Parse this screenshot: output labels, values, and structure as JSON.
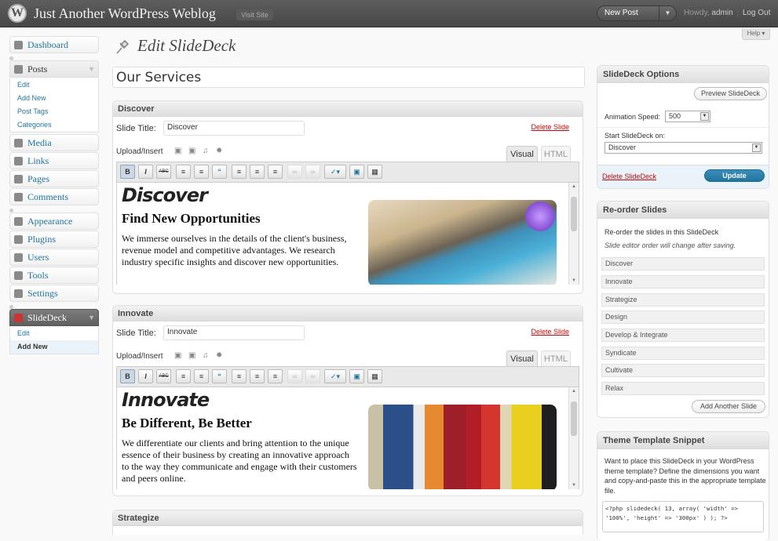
{
  "header": {
    "logo": "W",
    "site_title": "Just Another WordPress Weblog",
    "visit_site": "Visit Site",
    "new_post": "New Post",
    "new_post_arrow": "▼",
    "howdy": "Howdy,",
    "user": "admin",
    "sep": "|",
    "logout": "Log Out"
  },
  "help": "Help ▾",
  "menu": {
    "dashboard": "Dashboard",
    "posts": "Posts",
    "posts_sub": [
      "Edit",
      "Add New",
      "Post Tags",
      "Categories"
    ],
    "media": "Media",
    "links": "Links",
    "pages": "Pages",
    "comments": "Comments",
    "appearance": "Appearance",
    "plugins": "Plugins",
    "users": "Users",
    "tools": "Tools",
    "settings": "Settings",
    "slidedeck": "SlideDeck",
    "slidedeck_sub": [
      "Edit",
      "Add New"
    ]
  },
  "page": {
    "title": "Edit SlideDeck",
    "deck_name": "Our Services"
  },
  "slides": [
    {
      "header": "Discover",
      "title_label": "Slide Title:",
      "title_value": "Discover",
      "delete": "Delete Slide",
      "upload": "Upload/Insert",
      "visual": "Visual",
      "html": "HTML",
      "h1": "Discover",
      "h3": "Find New Opportunities",
      "body": "We immerse ourselves in the details of the client's business, revenue model and competitive advantages. We research industry specific insights and discover new opportunities."
    },
    {
      "header": "Innovate",
      "title_label": "Slide Title:",
      "title_value": "Innovate",
      "delete": "Delete Slide",
      "upload": "Upload/Insert",
      "visual": "Visual",
      "html": "HTML",
      "h1": "Innovate",
      "h3": "Be Different, Be Better",
      "body": "We differentiate our clients and bring attention to the unique essence of their business by creating an innovative approach to the way they communicate and engage with their customers and peers online."
    },
    {
      "header": "Strategize"
    }
  ],
  "toolbar": {
    "bold": "B",
    "italic": "I",
    "strike": "ABC",
    "bullets": "≡",
    "numbers": "≡",
    "quote": "“",
    "align_left": "≡",
    "align_center": "≡",
    "align_right": "≡",
    "link": "∞",
    "unlink": "∞",
    "spell": "✓",
    "spell_arrow": "▾",
    "fullscreen": "▣",
    "kitchen": "▦"
  },
  "media_icons": [
    "▣",
    "▣",
    "♫",
    "✹"
  ],
  "options": {
    "header": "SlideDeck Options",
    "preview": "Preview SlideDeck",
    "speed_label": "Animation Speed:",
    "speed_value": "500",
    "start_label": "Start SlideDeck on:",
    "start_value": "Discover",
    "delete": "Delete SlideDeck",
    "update": "Update"
  },
  "reorder": {
    "header": "Re-order Slides",
    "desc": "Re-order the slides in this SlideDeck",
    "note": "Slide editor order will change after saving.",
    "items": [
      "Discover",
      "Innovate",
      "Strategize",
      "Design",
      "Develop & Integrate",
      "Syndicate",
      "Cultivate",
      "Relax"
    ],
    "add": "Add Another Slide"
  },
  "snippet": {
    "header": "Theme Template Snippet",
    "desc": "Want to place this SlideDeck in your WordPress theme template? Define the dimensions you want and copy-and-paste this in the appropriate template file.",
    "code_line1": "<?php slidedeck( 13, array( 'width' =>",
    "code_line2": "'100%', 'height' => '300px' ) ); ?>"
  },
  "colors": {
    "link": "#21759b",
    "delete": "#bc0b0b",
    "update": "#21759b",
    "header_bg": "#464646"
  }
}
